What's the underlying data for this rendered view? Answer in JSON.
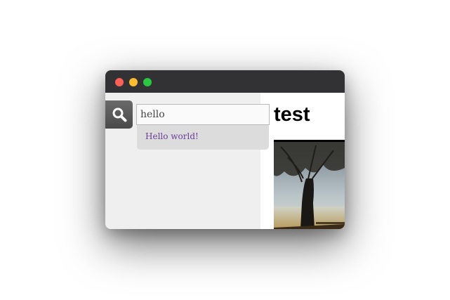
{
  "search": {
    "value": "hello",
    "icon": "search-icon"
  },
  "suggestions": [
    {
      "label": "Hello world!"
    }
  ],
  "page": {
    "title": "test"
  },
  "colors": {
    "titlebar": "#323234",
    "close": "#ff5f57",
    "minimize": "#febc2e",
    "maximize": "#28c840",
    "sidebar": "#efefef",
    "suggestion_bg": "#dcdcdc",
    "link": "#6a3d98"
  }
}
